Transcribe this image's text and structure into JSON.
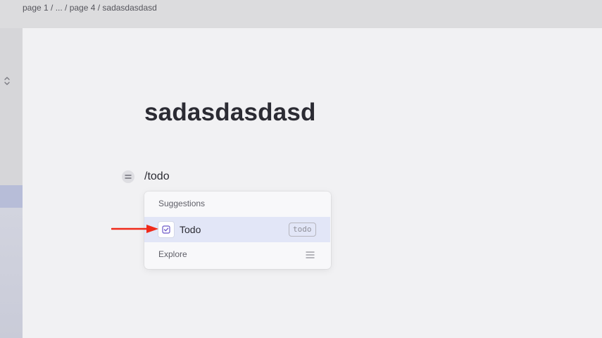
{
  "breadcrumb": {
    "text": "page 1 / ... / page 4 / sadasdasdasd"
  },
  "sidebar": {
    "toggle_icon": "chevron-up-down-icon"
  },
  "page": {
    "title": "sadasdasdasd",
    "block_text": "/todo",
    "block_handle_icon": "equals-drag-icon"
  },
  "menu": {
    "header": "Suggestions",
    "items": [
      {
        "label": "Todo",
        "shortcut": "todo",
        "icon": "checkbox-icon",
        "selected": true
      }
    ],
    "explore": {
      "label": "Explore",
      "icon": "menu-lines-icon"
    }
  },
  "annotation": {
    "arrow_color": "#f02a1a",
    "icon": "red-arrow-icon"
  },
  "colors": {
    "selected_item_bg": "#e2e6f7",
    "checkbox_accent": "#6b57c8",
    "editor_bg": "#f1f1f3"
  }
}
